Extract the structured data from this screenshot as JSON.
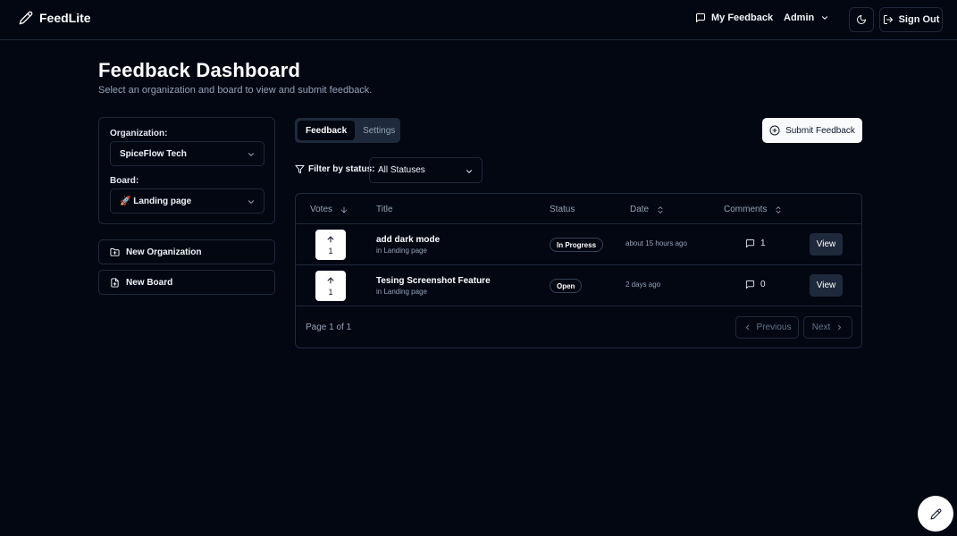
{
  "header": {
    "brand": "FeedLite",
    "my_feedback": "My Feedback",
    "admin": "Admin",
    "sign_out": "Sign Out"
  },
  "page": {
    "title": "Feedback Dashboard",
    "subtitle": "Select an organization and board to view and submit feedback."
  },
  "sidebar": {
    "organization_label": "Organization:",
    "organization_value": "SpiceFlow Tech",
    "board_label": "Board:",
    "board_value": "🚀 Landing page",
    "new_organization": "New Organization",
    "new_board": "New Board"
  },
  "tabs": [
    {
      "label": "Feedback",
      "active": true
    },
    {
      "label": "Settings",
      "active": false
    }
  ],
  "submit_button": "Submit Feedback",
  "filter": {
    "label": "Filter by status:",
    "value": "All Statuses"
  },
  "table": {
    "columns": {
      "votes": "Votes",
      "title": "Title",
      "status": "Status",
      "date": "Date",
      "comments": "Comments"
    },
    "rows": [
      {
        "votes": "1",
        "title": "add dark mode",
        "board": "in Landing page",
        "status": "In Progress",
        "date": "about 15 hours ago",
        "comments": "1",
        "view": "View"
      },
      {
        "votes": "1",
        "title": "Tesing Screenshot Feature",
        "board": "in Landing page",
        "status": "Open",
        "date": "2 days ago",
        "comments": "0",
        "view": "View"
      }
    ],
    "pagination": {
      "info": "Page 1 of 1",
      "previous": "Previous",
      "next": "Next"
    }
  },
  "colors": {
    "background": "#030712",
    "border": "#1e293b",
    "muted_text": "#94a3b8",
    "primary_button": "#f8fafc"
  },
  "icons": {
    "brand": "pencil-icon",
    "my_feedback": "message-square-icon",
    "admin_menu": "chevron-down-icon",
    "theme": "moon-icon",
    "sign_out": "log-out-icon",
    "submit": "plus-circle-icon",
    "filter": "filter-icon",
    "new_organization": "folder-plus-icon",
    "new_board": "file-plus-icon",
    "fab": "pencil-icon"
  }
}
